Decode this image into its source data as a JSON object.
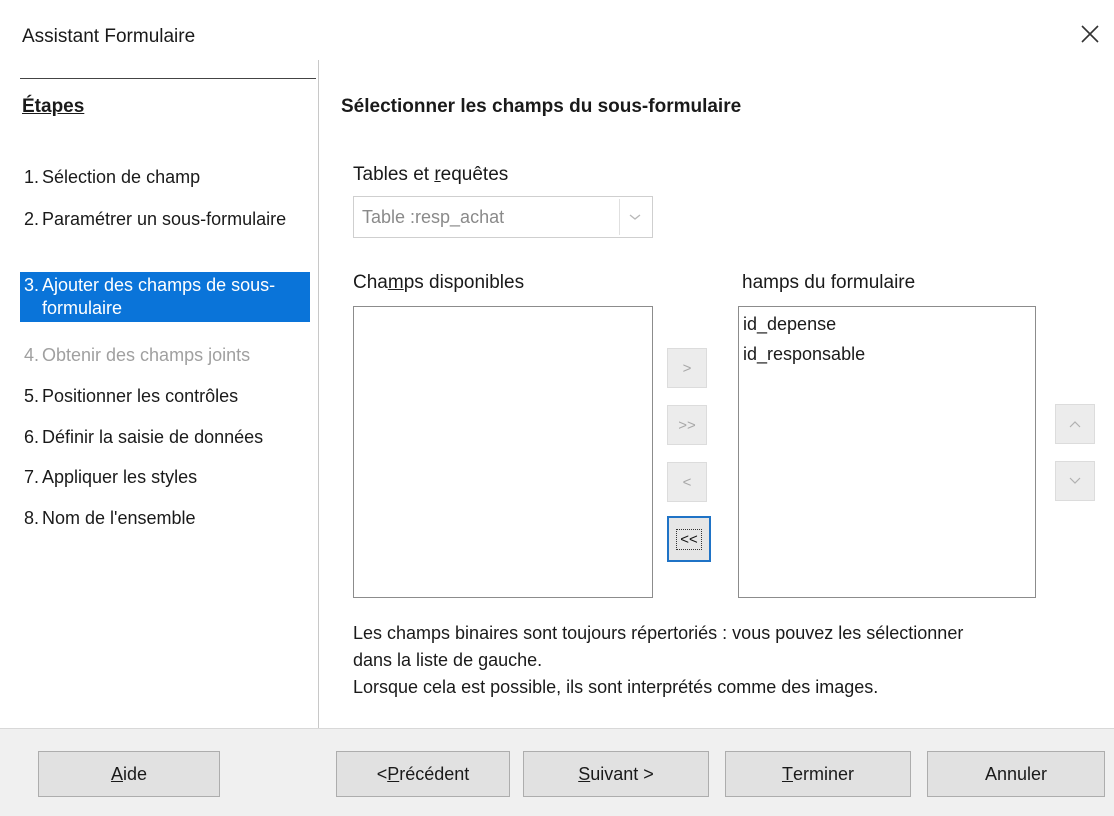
{
  "window": {
    "title": "Assistant Formulaire",
    "close_icon": "close-icon"
  },
  "sidebar": {
    "heading": "Étapes",
    "steps": [
      {
        "num": "1.",
        "label": "Sélection de champ",
        "state": "normal"
      },
      {
        "num": "2.",
        "label": "Paramétrer un sous-formulaire",
        "state": "normal"
      },
      {
        "num": "3.",
        "label": "Ajouter des champs de sous-formulaire",
        "state": "active"
      },
      {
        "num": "4.",
        "label": "Obtenir des champs joints",
        "state": "disabled"
      },
      {
        "num": "5.",
        "label": "Positionner les contrôles",
        "state": "normal"
      },
      {
        "num": "6.",
        "label": "Définir la saisie de données",
        "state": "normal"
      },
      {
        "num": "7.",
        "label": "Appliquer les styles",
        "state": "normal"
      },
      {
        "num": "8.",
        "label": "Nom de l'ensemble",
        "state": "normal"
      }
    ]
  },
  "main": {
    "title": "Sélectionner les champs du sous-formulaire",
    "tables_label_pre": "Tables et ",
    "tables_label_u": "r",
    "tables_label_post": "equêtes",
    "tables_select_value": "Table :resp_achat",
    "available_label_pre": "Cha",
    "available_label_u": "m",
    "available_label_post": "ps disponibles",
    "available_items": [],
    "form_fields_label": "Champs du formulaire",
    "form_fields_label_shown": "hamps du formulaire",
    "form_fields_items": [
      "id_depense",
      "id_responsable"
    ],
    "move_buttons": {
      "add_one": ">",
      "add_all": ">>",
      "remove_one": "<",
      "remove_all": "<<"
    },
    "order_buttons": {
      "up": "^",
      "down": "v"
    },
    "info_line1": "Les champs binaires sont toujours répertoriés : vous pouvez les sélectionner",
    "info_line2": "dans la liste de gauche.",
    "info_line3": "Lorsque cela est possible, ils sont interprétés comme des images."
  },
  "footer": {
    "help_u": "A",
    "help_rest": "ide",
    "prev_pre": "< ",
    "prev_u": "P",
    "prev_rest": "récédent",
    "next_u": "S",
    "next_rest": "uivant >",
    "finish_u": "T",
    "finish_rest": "erminer",
    "cancel": "Annuler"
  },
  "colors": {
    "accent": "#0a74d9",
    "disabled_text": "#a0a0a0",
    "focus_border": "#1f73c6"
  }
}
